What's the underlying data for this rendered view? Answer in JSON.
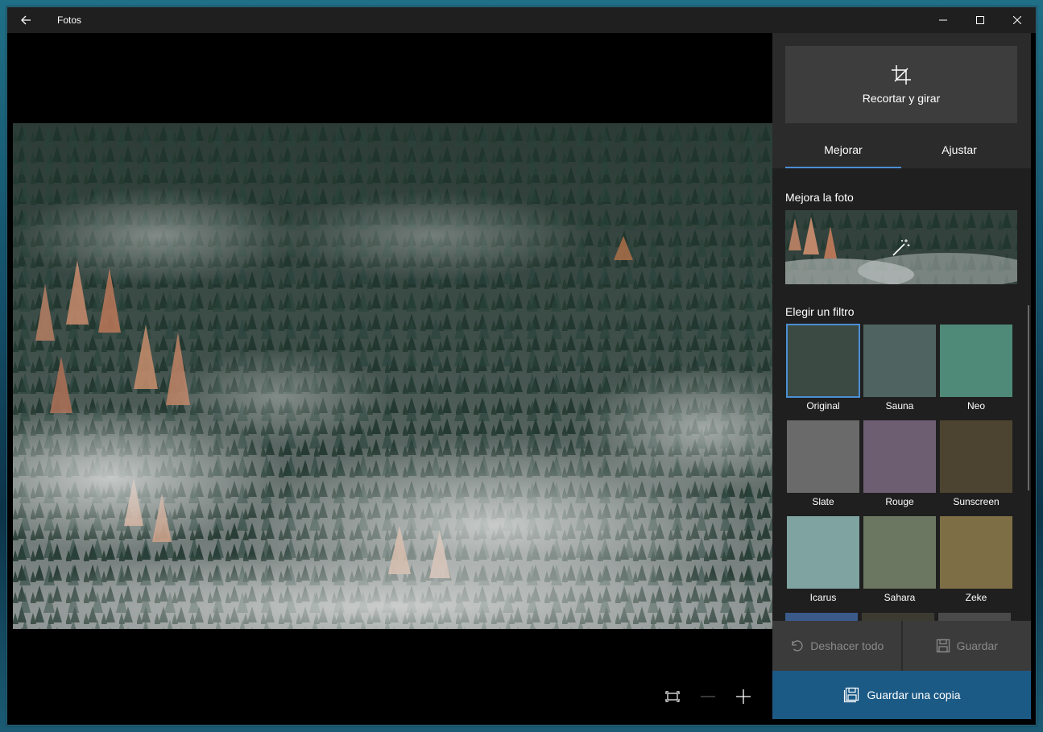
{
  "window": {
    "title": "Fotos"
  },
  "panel": {
    "crop_label": "Recortar y girar",
    "tabs": [
      {
        "label": "Mejorar",
        "active": true
      },
      {
        "label": "Ajustar",
        "active": false
      }
    ],
    "enhance_label": "Mejora la foto",
    "filter_label": "Elegir un filtro",
    "filters": [
      {
        "name": "Original",
        "tint": "#3c4a44",
        "selected": true
      },
      {
        "name": "Sauna",
        "tint": "#4f6461",
        "selected": false
      },
      {
        "name": "Neo",
        "tint": "#4f8a78",
        "selected": false
      },
      {
        "name": "Slate",
        "tint": "#6a6a6a",
        "selected": false
      },
      {
        "name": "Rouge",
        "tint": "#6d5e72",
        "selected": false
      },
      {
        "name": "Sunscreen",
        "tint": "#4c4430",
        "selected": false
      },
      {
        "name": "Icarus",
        "tint": "#7fa3a0",
        "selected": false
      },
      {
        "name": "Sahara",
        "tint": "#6b7760",
        "selected": false
      },
      {
        "name": "Zeke",
        "tint": "#7d6e45",
        "selected": false
      }
    ],
    "undo_label": "Deshacer todo",
    "save_label": "Guardar",
    "save_copy_label": "Guardar una copia"
  },
  "colors": {
    "accent": "#4a8fd3",
    "save_copy_bg": "#1c5a86",
    "panel_bg": "#2b2b2b"
  }
}
